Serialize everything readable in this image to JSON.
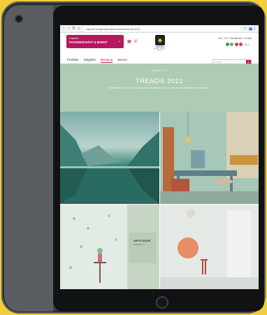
{
  "browser": {
    "url": "caparol.de/gestaltung/trendwelt/trends-2021"
  },
  "header": {
    "store_label": "Caparol",
    "store_name": "FACHGESCHÄFT & MARKT",
    "logo_text": "CAPAROL",
    "logo_sub": "FARBE · LACKE · BAUTEN",
    "top_links": "Kurz · EN · Fachhändler · Kontakt",
    "lang_label": "DE ▾",
    "search_placeholder": "Suchen"
  },
  "nav": {
    "items": [
      "Produkte",
      "Ratgeber",
      "Beratung",
      "Service"
    ]
  },
  "hero": {
    "breadcrumb": "Gestaltung > 21",
    "title": "TRENDS 2021",
    "text": "Entdecken Sie die Farbtrends 2021 und lassen Sie sich von den Kombinationen inspirieren."
  },
  "tile3": {
    "card_title": "ART'S EDGE",
    "card_sub": "Kollektion 21"
  },
  "colors": {
    "brand": "#b5185f",
    "hero_bg": "#aecbb4",
    "device": "#44474b",
    "background": "#f2cf3a"
  },
  "icons": [
    "back-icon",
    "forward-icon",
    "reload-icon",
    "home-icon",
    "star-icon",
    "profile-icon",
    "menu-icon",
    "store-icon",
    "phone-icon",
    "search-icon"
  ]
}
